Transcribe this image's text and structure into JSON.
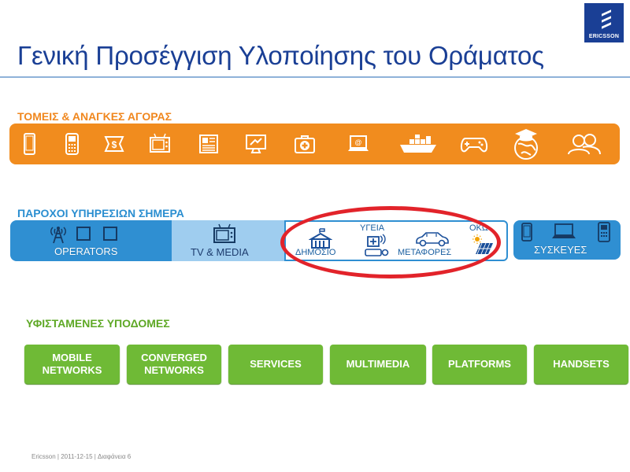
{
  "header": {
    "logo_text": "ERICSSON",
    "title": "Γενική Προσέγγιση Υλοποίησης του Οράματος"
  },
  "markets": {
    "heading": "ΤΟΜΕΙΣ & ΑΝΑΓΚΕΣ ΑΓΟΡΑΣ",
    "icons": [
      "smartphone-icon",
      "mobile-phone-icon",
      "money-icon",
      "television-icon",
      "newspaper-icon",
      "screen-icon",
      "first-aid-kit-icon",
      "laptop-icon",
      "cargo-ship-icon",
      "gamepad-icon",
      "graduation-globe-icon",
      "people-icon"
    ]
  },
  "providers": {
    "heading": "ΠΑΡΟΧΟΙ ΥΠΗΡΕΣΙΩΝ ΣΗΜΕΡΑ",
    "operators": "OPERATORS",
    "tv_media": "TV & MEDIA",
    "public": "ΔΗΜΟΣΙΟ",
    "health": "ΥΓΕΙΑ",
    "transport": "ΜΕΤΑΦΟΡΕΣ",
    "utilities": "ΟΚΩ",
    "devices": "ΣΥΣΚΕΥΕΣ"
  },
  "infrastructure": {
    "heading": "ΥΦΙΣΤΑΜΕΝΕΣ ΥΠΟΔΟΜΕΣ",
    "buttons": [
      {
        "line1": "MOBILE",
        "line2": "NETWORKS"
      },
      {
        "line1": "CONVERGED",
        "line2": "NETWORKS"
      },
      {
        "line1": "SERVICES",
        "line2": ""
      },
      {
        "line1": "MULTIMEDIA",
        "line2": ""
      },
      {
        "line1": "PLATFORMS",
        "line2": ""
      },
      {
        "line1": "HANDSETS",
        "line2": ""
      }
    ]
  },
  "footer": {
    "text": "Ericsson | 2011-12-15 | Διαφάνεια 6"
  },
  "colors": {
    "brand_blue": "#1a3f95",
    "orange": "#f18c1e",
    "blue": "#2f8fd2",
    "light_blue": "#9fcdef",
    "green": "#6fba36",
    "red_ring": "#e2232a"
  }
}
